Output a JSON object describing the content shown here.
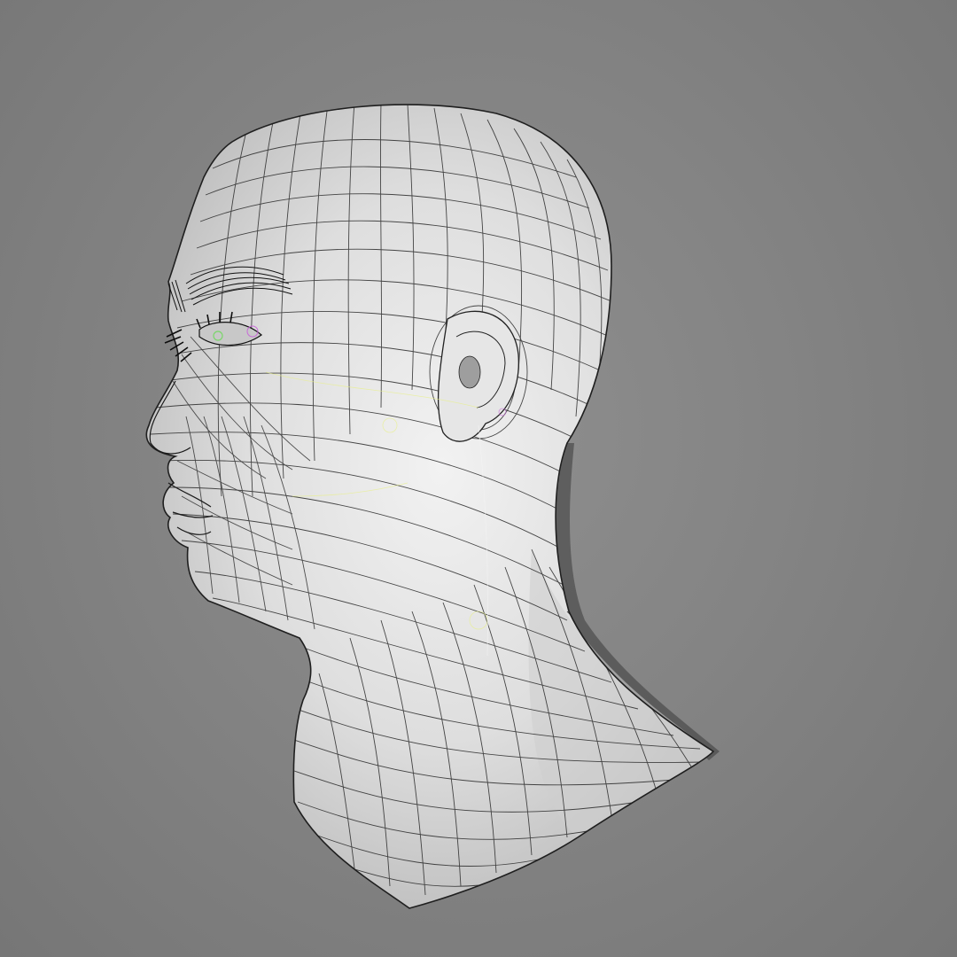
{
  "viewport": {
    "background_color": "#858585",
    "model": {
      "subject": "head-and-neck",
      "display_mode": "wireframe-on-shaded",
      "surface_color": "#dcdcdc",
      "wire_color": "#2a2a2a",
      "rig_helper_colors": [
        "#e8f08a",
        "#c86ad8",
        "#7ad66a"
      ],
      "detail_icons": [
        "eyebrow-hair-icon",
        "eyelash-icon",
        "eye-icon",
        "ear-icon"
      ]
    }
  }
}
